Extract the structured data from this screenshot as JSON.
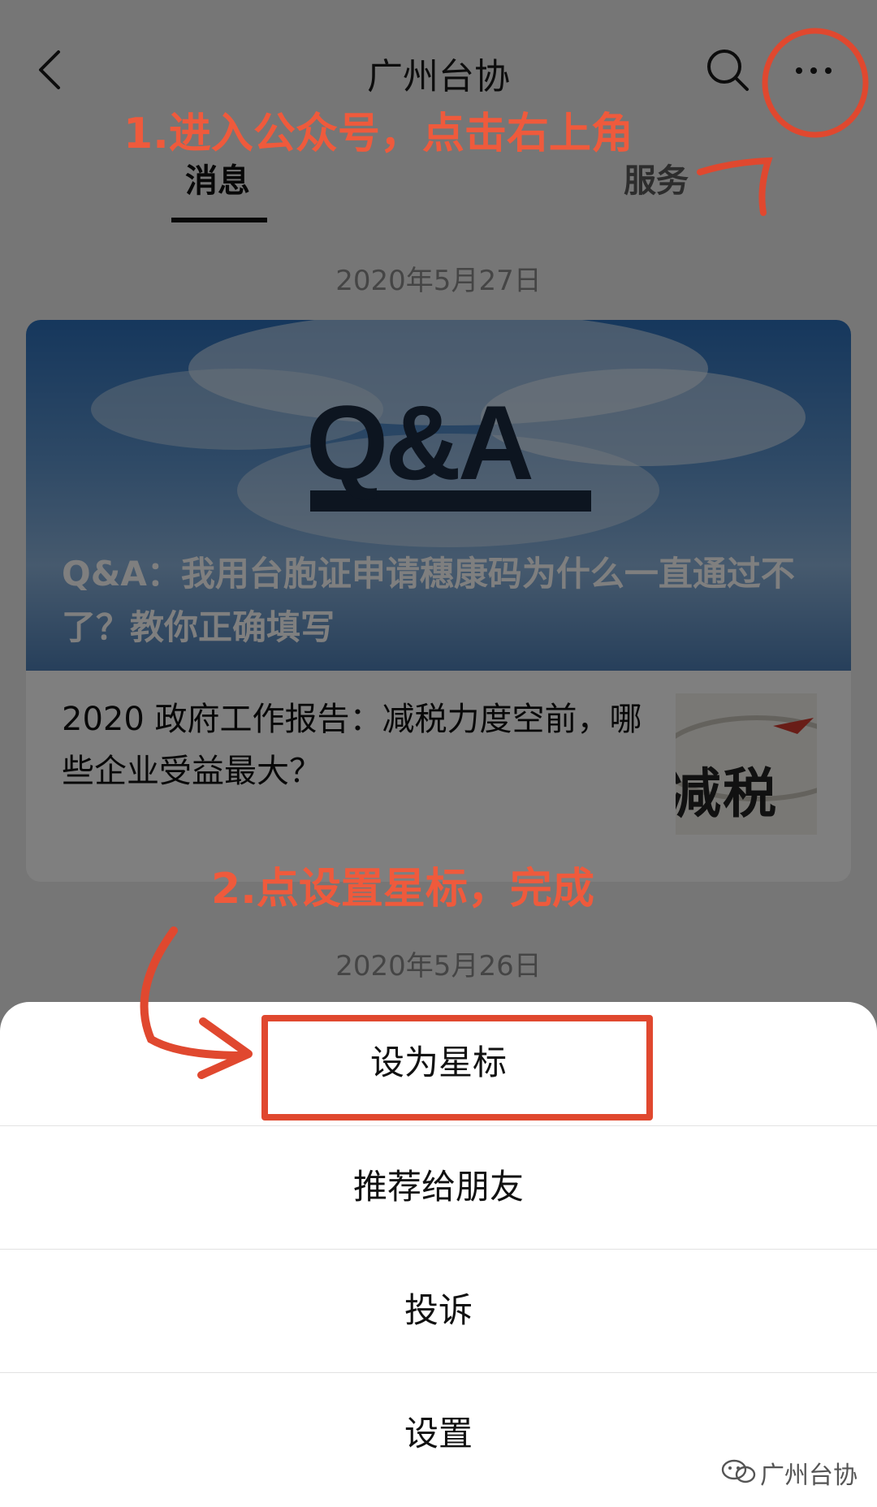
{
  "header": {
    "title": "广州台协"
  },
  "tabs": [
    {
      "label": "消息"
    },
    {
      "label": "服务"
    }
  ],
  "feed": {
    "date1": "2020年5月27日",
    "article1": {
      "cover_text": "Q&A",
      "title": "Q&A：我用台胞证申请穗康码为什么一直通过不了？教你正确填写"
    },
    "article2": {
      "title": "2020 政府工作报告：减税力度空前，哪些企业受益最大？",
      "thumb_text": "减税"
    },
    "date2": "2020年5月26日"
  },
  "sheet": {
    "items": [
      {
        "label": "设为星标"
      },
      {
        "label": "推荐给朋友"
      },
      {
        "label": "投诉"
      },
      {
        "label": "设置"
      }
    ]
  },
  "annotations": {
    "step1": "1.进入公众号，点击右上角",
    "step2": "2.点设置星标，完成",
    "color": "#ef5a3c"
  },
  "watermark": {
    "text": "广州台协"
  },
  "icons": {
    "back": "chevron-left-icon",
    "search": "search-icon",
    "more": "more-dots-icon"
  }
}
